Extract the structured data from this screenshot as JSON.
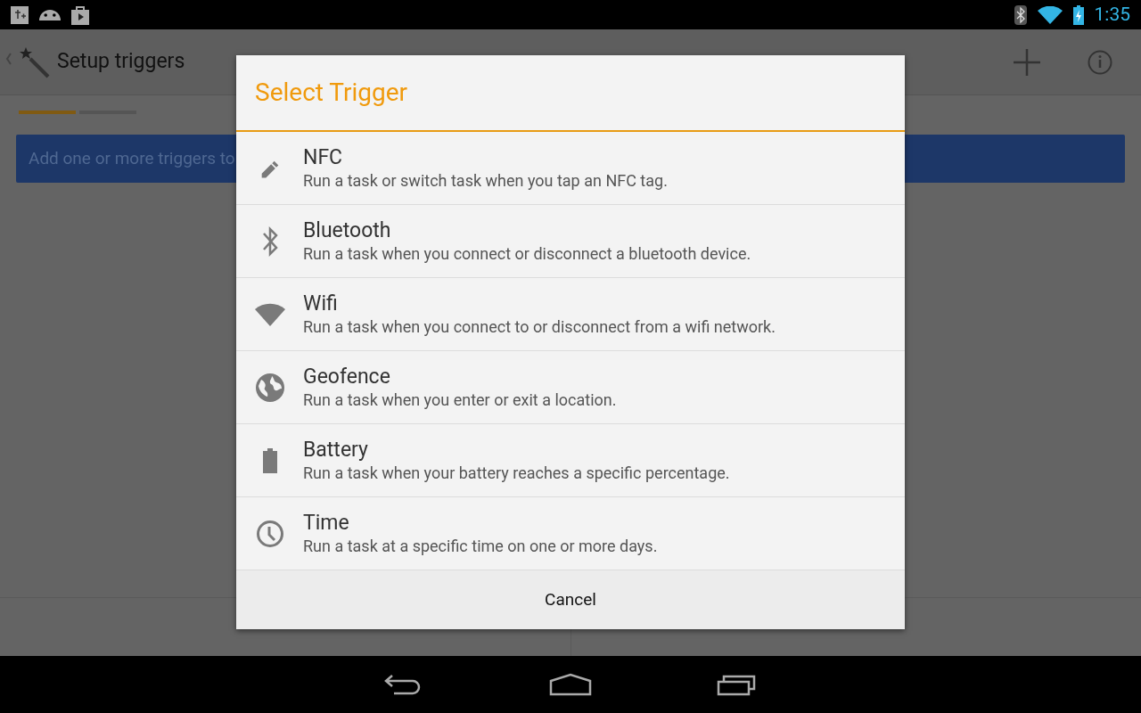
{
  "status_bar": {
    "time": "1:35"
  },
  "action_bar": {
    "title": "Setup triggers"
  },
  "steps": [
    {
      "selected": true
    },
    {
      "selected": false
    }
  ],
  "banner": {
    "text": "Add one or more triggers to"
  },
  "dialog": {
    "title": "Select Trigger",
    "items": [
      {
        "kind": "nfc",
        "label": "NFC",
        "description": "Run a task or switch task when you tap an NFC tag."
      },
      {
        "kind": "bluetooth",
        "label": "Bluetooth",
        "description": "Run a task when you connect or disconnect a bluetooth device."
      },
      {
        "kind": "wifi",
        "label": "Wifi",
        "description": "Run a task when you connect to or disconnect from a wifi network."
      },
      {
        "kind": "geofence",
        "label": "Geofence",
        "description": "Run a task when you enter or exit a location."
      },
      {
        "kind": "battery",
        "label": "Battery",
        "description": "Run a task when your battery reaches a specific percentage."
      },
      {
        "kind": "time",
        "label": "Time",
        "description": "Run a task at a specific time on one or more days."
      }
    ],
    "cancel": "Cancel"
  }
}
